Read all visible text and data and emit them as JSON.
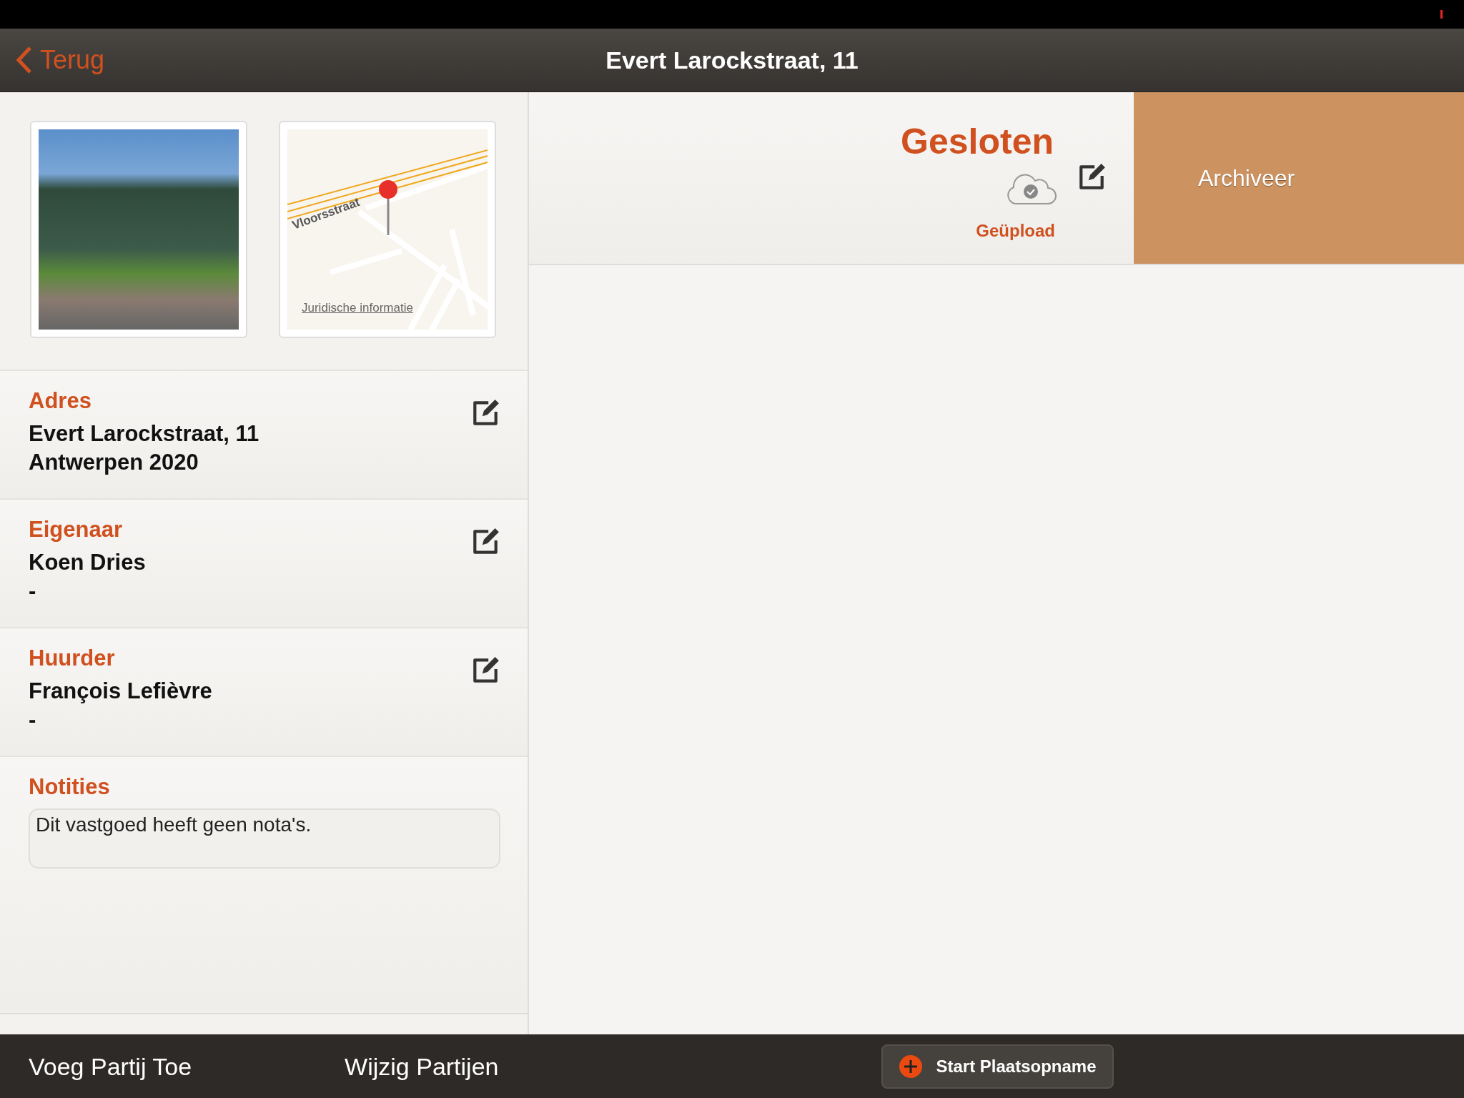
{
  "nav": {
    "back": "Terug",
    "title": "Evert Larockstraat, 11"
  },
  "map": {
    "street": "Vloorsstraat",
    "legal_link": "Juridische informatie"
  },
  "sections": [
    {
      "kind": "info",
      "label": "Adres",
      "lines": [
        "Evert Larockstraat, 11",
        "Antwerpen 2020"
      ]
    },
    {
      "kind": "info",
      "label": "Eigenaar",
      "lines": [
        "Koen Dries",
        "-"
      ]
    },
    {
      "kind": "info",
      "label": "Huurder",
      "lines": [
        "François Lefièvre",
        "-"
      ]
    },
    {
      "kind": "notes",
      "label": "Notities",
      "placeholder": "Dit vastgoed heeft geen nota's."
    }
  ],
  "status": {
    "title": "Gesloten",
    "upload": "Geüpload",
    "archive": "Archiveer"
  },
  "toolbar": {
    "add": "Voeg Partij Toe",
    "edit": "Wijzig Partijen",
    "start": "Start Plaatsopname"
  }
}
